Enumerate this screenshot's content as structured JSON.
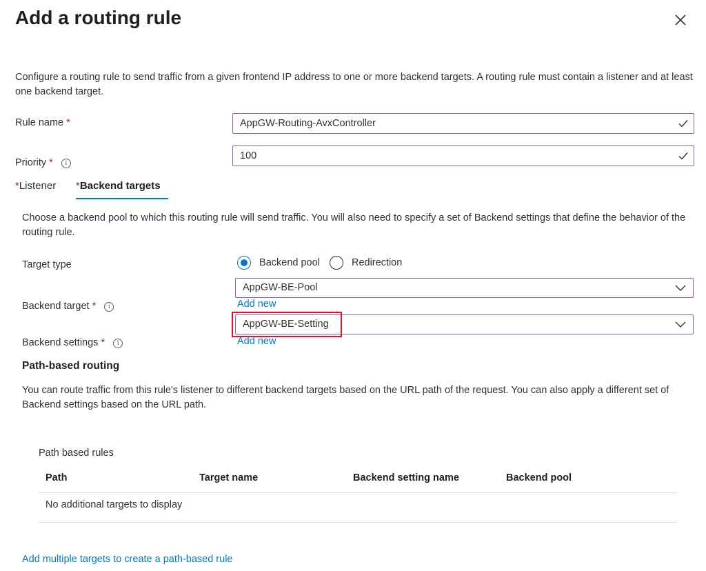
{
  "title": "Add a routing rule",
  "description": "Configure a routing rule to send traffic from a given frontend IP address to one or more backend targets. A routing rule must contain a listener and at least one backend target.",
  "rule_name": {
    "label": "Rule name",
    "required_mark": "*",
    "value": "AppGW-Routing-AvxController"
  },
  "priority": {
    "label": "Priority",
    "required_mark": "*",
    "value": "100"
  },
  "tabs": [
    {
      "required_mark": "*",
      "label": "Listener"
    },
    {
      "required_mark": "*",
      "label": "Backend targets"
    }
  ],
  "backend_description": "Choose a backend pool to which this routing rule will send traffic. You will also need to specify a set of Backend settings that define the behavior of the routing rule.",
  "target_type": {
    "label": "Target type",
    "options": [
      "Backend pool",
      "Redirection"
    ],
    "selected": "Backend pool"
  },
  "backend_target": {
    "label": "Backend target",
    "required_mark": "*",
    "value": "AppGW-BE-Pool",
    "add_new": "Add new"
  },
  "backend_settings": {
    "label": "Backend settings",
    "required_mark": "*",
    "value": "AppGW-BE-Setting",
    "add_new": "Add new"
  },
  "path_routing": {
    "heading": "Path-based routing",
    "description": "You can route traffic from this rule's listener to different backend targets based on the URL path of the request. You can also apply a different set of Backend settings based on the URL path.",
    "table_title": "Path based rules",
    "columns": [
      "Path",
      "Target name",
      "Backend setting name",
      "Backend pool"
    ],
    "empty_text": "No additional targets to display",
    "add_link": "Add multiple targets to create a path-based rule"
  },
  "colors": {
    "accent": "#0078d4",
    "required": "#a4262c",
    "input_border": "#8a5fb6",
    "highlight": "#e81123"
  }
}
